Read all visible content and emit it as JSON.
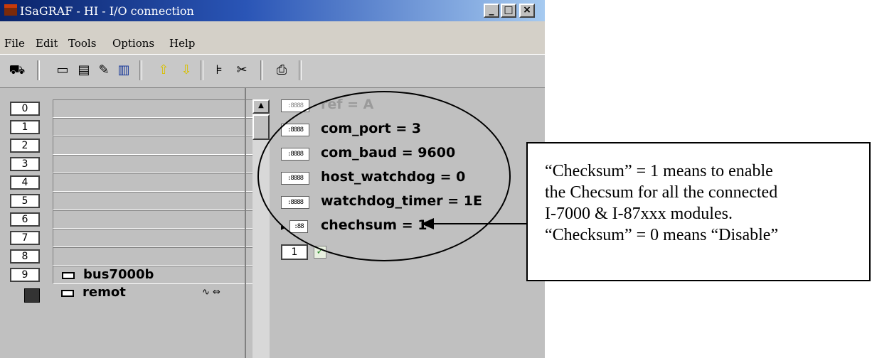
{
  "window": {
    "title": "ISaGRAF - HI - I/O connection",
    "controls": {
      "minimize": "_",
      "maximize": "□",
      "close": "×"
    }
  },
  "menu": [
    "File",
    "Edit",
    "Tools",
    "Options",
    "Help"
  ],
  "toolbar": {
    "icons": [
      "board-icon",
      "connect-icon",
      "parameters-icon",
      "properties-icon",
      "delete-icon",
      "up-arrow-icon",
      "down-arrow-icon",
      "insert-icon",
      "cut-icon",
      "print-icon"
    ]
  },
  "slots": [
    {
      "num": "0",
      "label": ""
    },
    {
      "num": "1",
      "label": ""
    },
    {
      "num": "2",
      "label": ""
    },
    {
      "num": "3",
      "label": ""
    },
    {
      "num": "4",
      "label": ""
    },
    {
      "num": "5",
      "label": ""
    },
    {
      "num": "6",
      "label": ""
    },
    {
      "num": "7",
      "label": ""
    },
    {
      "num": "8",
      "label": ""
    },
    {
      "num": "9",
      "label": "bus7000b"
    },
    {
      "num": "",
      "label": "remot"
    }
  ],
  "slot_extra": {
    "remot_suffix": "∿ ⇔"
  },
  "parameters": [
    {
      "text": "ref = A"
    },
    {
      "text": "com_port = 3"
    },
    {
      "text": "com_baud = 9600"
    },
    {
      "text": "host_watchdog = 0"
    },
    {
      "text": "watchdog_timer = 1E"
    },
    {
      "text": "chechsum = 1"
    }
  ],
  "param_icon_text": ":8888",
  "param_icon_small_text": ":88",
  "channel": {
    "num": "1",
    "check": "✓"
  },
  "annotation": {
    "lines": [
      "“Checksum” = 1 means to enable",
      "the Checsum for all the connected",
      "I-7000 & I-87xxx modules.",
      "“Checksum” = 0 means “Disable”"
    ]
  }
}
